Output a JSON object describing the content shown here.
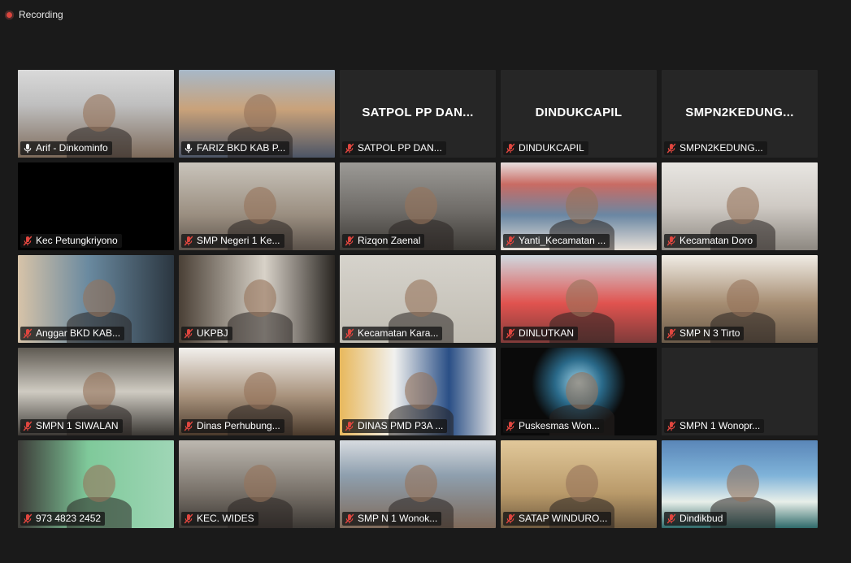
{
  "recording": {
    "label": "Recording"
  },
  "participants": [
    {
      "name": "Arif - Dinkominfo",
      "mic": "on",
      "video": true
    },
    {
      "name": "FARIZ BKD KAB P...",
      "mic": "on",
      "video": true
    },
    {
      "name": "SATPOL PP DAN...",
      "mic": "muted",
      "video": false,
      "center": "SATPOL PP DAN..."
    },
    {
      "name": "DINDUKCAPIL",
      "mic": "muted",
      "video": false,
      "center": "DINDUKCAPIL"
    },
    {
      "name": "SMPN2KEDUNG...",
      "mic": "muted",
      "video": false,
      "center": "SMPN2KEDUNG..."
    },
    {
      "name": "Kec Petungkriyono",
      "mic": "muted",
      "video": true
    },
    {
      "name": "SMP Negeri 1 Ke...",
      "mic": "muted",
      "video": true
    },
    {
      "name": "Rizqon Zaenal",
      "mic": "muted",
      "video": true
    },
    {
      "name": "Yanti_Kecamatan ...",
      "mic": "muted",
      "video": true
    },
    {
      "name": "Kecamatan Doro",
      "mic": "muted",
      "video": true
    },
    {
      "name": "Anggar BKD KAB...",
      "mic": "muted",
      "video": true
    },
    {
      "name": "UKPBJ",
      "mic": "muted",
      "video": true
    },
    {
      "name": "Kecamatan Kara...",
      "mic": "muted",
      "video": true
    },
    {
      "name": "DINLUTKAN",
      "mic": "muted",
      "video": true
    },
    {
      "name": "SMP N 3 Tirto",
      "mic": "muted",
      "video": true
    },
    {
      "name": "SMPN 1 SIWALAN",
      "mic": "muted",
      "video": true
    },
    {
      "name": "Dinas Perhubung...",
      "mic": "muted",
      "video": true
    },
    {
      "name": "DINAS PMD P3A ...",
      "mic": "muted",
      "video": true
    },
    {
      "name": "Puskesmas Won...",
      "mic": "muted",
      "video": true
    },
    {
      "name": "SMPN 1 Wonopr...",
      "mic": "muted",
      "video": true
    },
    {
      "name": "973 4823 2452",
      "mic": "muted",
      "video": true
    },
    {
      "name": "KEC. WIDES",
      "mic": "muted",
      "video": true
    },
    {
      "name": "SMP N 1 Wonok...",
      "mic": "muted",
      "video": true
    },
    {
      "name": "SATAP WINDURO...",
      "mic": "muted",
      "video": true
    },
    {
      "name": "Dindikbud",
      "mic": "muted",
      "video": true
    }
  ],
  "scenes": [
    "linear-gradient(180deg,#d9d9d9 0%,#bfbfbf 40%,#7d6a5a 100%)",
    "linear-gradient(180deg,#a7b8c8 0%,#c9a27a 45%,#4c5566 100%)",
    "",
    "",
    "",
    "#000000",
    "linear-gradient(180deg,#c9c4bb 0%,#9a8e80 60%,#5b524a 100%)",
    "linear-gradient(180deg,#9c9a96 0%,#6f6c68 55%,#3d3a36 100%)",
    "linear-gradient(180deg,#e7dede 0%,#c96b63 25%,#6a87a3 60%,#e9e1d9 100%)",
    "linear-gradient(180deg,#e8e6e2 0%,#cfcac4 50%,#8d8881 100%)",
    "linear-gradient(90deg,#d7c3a8 0%,#6a8aa0 45%,#2b3640 100%)",
    "linear-gradient(90deg,#4a4036 0%,#d8d2c8 55%,#2a2622 100%)",
    "linear-gradient(180deg,#d6d3cc 0%,#c0bcb2 100%)",
    "linear-gradient(180deg,#cfd8df 0%,#e0534f 55%,#7f3b3a 100%)",
    "linear-gradient(180deg,#f0ece5 0%,#a68d72 55%,#6a5a49 100%)",
    "linear-gradient(180deg,#5f5a52 0%,#cfcbc2 50%,#3c3935 100%)",
    "linear-gradient(180deg,#f2f0ed 0%,#a8927c 55%,#4a3a2c 100%)",
    "linear-gradient(90deg,#e8b85c 0%,#f1f1ef 35%,#2a4f86 70%,#e6e6e6 100%)",
    "radial-gradient(circle at 50% 40%,#9fd3e8 0%,#2a6a8a 25%,#0a0a0a 50%)",
    "linear-gradient(180deg,#262626 0%,#262626 100%)",
    "linear-gradient(90deg,#3c3b38 0%,#7fc99a 45%,#9fd6b6 100%)",
    "linear-gradient(180deg,#bdb8b0 0%,#777068 60%,#3c3834 100%)",
    "linear-gradient(180deg,#d7dbe0 0%,#8e9fae 40%,#7f6a5a 100%)",
    "linear-gradient(180deg,#e1c89a 0%,#b99a6a 60%,#6f5a3f 100%)",
    "linear-gradient(180deg,#5a86b8 0%,#7fb3d9 40%,#e8efe9 70%,#2f6a6a 100%)"
  ]
}
